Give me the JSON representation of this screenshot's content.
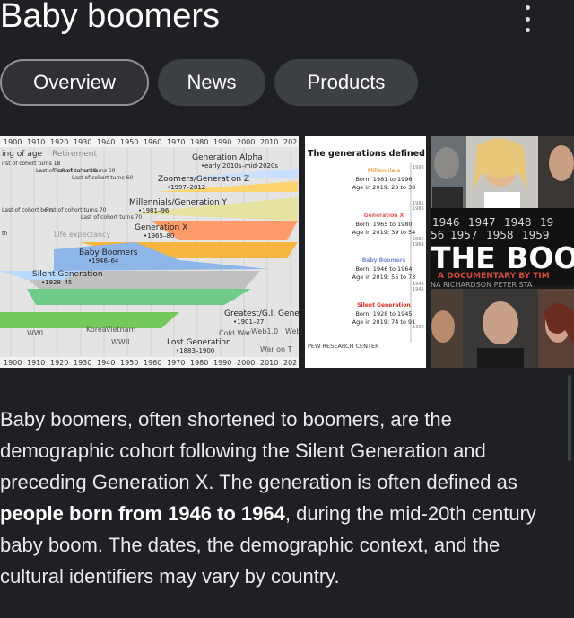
{
  "header": {
    "title": "Baby boomers",
    "more_icon": "vertical-ellipsis-icon"
  },
  "chips": [
    {
      "label": "Overview",
      "selected": true
    },
    {
      "label": "News",
      "selected": false
    },
    {
      "label": "Products",
      "selected": false
    }
  ],
  "images": {
    "timeline": {
      "years": [
        "1900",
        "1910",
        "1920",
        "1930",
        "1940",
        "1950",
        "1960",
        "1970",
        "1980",
        "1990",
        "2000",
        "2010",
        "202"
      ],
      "top_labels": [
        "ing of age",
        "Retirement"
      ],
      "mid_labels": [
        "irst of cohort turns 18",
        "Last of cohort turns 18",
        "First of cohort turns 60",
        "Last of cohort turns 60"
      ],
      "side_labels": [
        "Last of cohort born",
        "First of cohort turns 70",
        "Last of cohort turns 70",
        "Life expectancy",
        "th"
      ],
      "generations": [
        {
          "name": "Generation Alpha",
          "years": "early 2010s–mid-2020s"
        },
        {
          "name": "Zoomers/Generation Z",
          "years": "1997–2012"
        },
        {
          "name": "Millennials/Generation Y",
          "years": "1981–96"
        },
        {
          "name": "Generation X",
          "years": "1965–80"
        },
        {
          "name": "Baby Boomers",
          "years": "1946–64"
        },
        {
          "name": "Silent Generation",
          "years": "1928–45"
        },
        {
          "name": "Greatest/G.I. Gene",
          "years": "1901–27"
        },
        {
          "name": "Lost Generation",
          "years": "1883–1900"
        }
      ],
      "events": [
        "WWI",
        "WWII",
        "Korea",
        "Vietnam",
        "Cold War",
        "Web1.0",
        "Web2",
        "War on T"
      ]
    },
    "pew": {
      "title": "The generations defined",
      "blocks": [
        {
          "name": "Millennials",
          "born": "Born: 1981 to 1996",
          "age": "Age in 2019: 23 to 38",
          "color": "#f4a64b"
        },
        {
          "name": "Generation X",
          "born": "Born: 1965 to 1980",
          "age": "Age in 2019: 39 to 54",
          "color": "#e05c5c"
        },
        {
          "name": "Baby Boomers",
          "born": "Born: 1946 to 1964",
          "age": "Age in 2019: 55 to 73",
          "color": "#7b8fd6"
        },
        {
          "name": "Silent Generation",
          "born": "Born: 1928 to 1945",
          "age": "Age in 2019: 74 to 91",
          "color": "#d6302b"
        }
      ],
      "axis_years": [
        "1996",
        "1981",
        "1980",
        "1965",
        "1964",
        "1946",
        "1945",
        "1928"
      ],
      "source": "PEW RESEARCH CENTER"
    },
    "poster": {
      "years_row1": [
        "1946",
        "1947",
        "1948",
        "19"
      ],
      "years_row2": [
        "56",
        "1957",
        "1958",
        "1959"
      ],
      "headline": "THE BOO",
      "subtitle": "A DOCUMENTARY BY TIM",
      "credit": "NA RICHARDSON PETER STA"
    }
  },
  "description": {
    "before": "Baby boomers, often shortened to boomers, are the demographic cohort following the Silent Generation and preceding Generation X. The generation is often defined as ",
    "bold": "people born from 1946 to 1964",
    "after": ", during the mid-20th century baby boom. The dates, the demographic context, and the cultural identifiers may vary by country."
  }
}
